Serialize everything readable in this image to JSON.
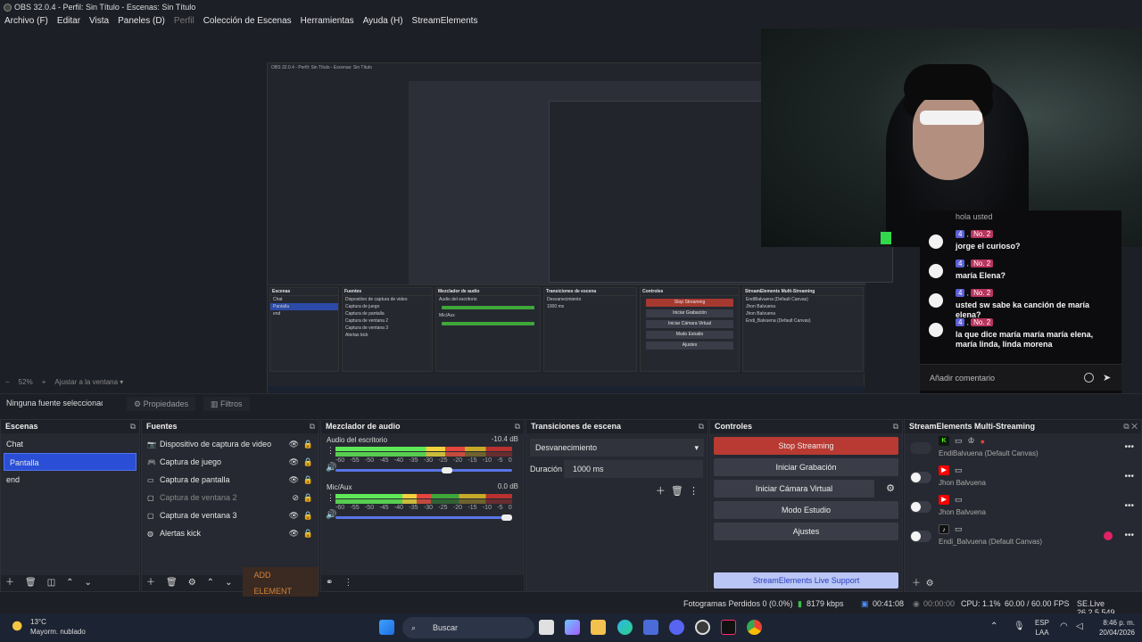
{
  "window_title": "OBS 32.0.4 - Perfil: Sin Título - Escenas: Sin Título",
  "menu": [
    "Archivo (F)",
    "Editar",
    "Vista",
    "Paneles (D)",
    "Perfil",
    "Colección de Escenas",
    "Herramientas",
    "Ayuda (H)",
    "StreamElements"
  ],
  "zoom": {
    "minus": "−",
    "value": "52%",
    "plus": "+",
    "fit": "Ajustar a la ventana"
  },
  "source_bar": {
    "label": "Ninguna fuente seleccionada",
    "properties": "Propiedades",
    "filters": "Filtros"
  },
  "chat": {
    "messages": [
      {
        "badge1": "4",
        "badge2": "No. 2",
        "text": "jorge el curioso?"
      },
      {
        "badge1": "4",
        "badge2": "No. 2",
        "text": "maría Elena?"
      },
      {
        "badge1": "4",
        "badge2": "No. 2",
        "text": "usted sw sabe ka canción de maría elena?"
      },
      {
        "badge1": "4",
        "badge2": "No. 2",
        "text": "la que dice maría maría maría elena, maría linda, linda morena"
      }
    ],
    "partial_top": "hola usted",
    "placeholder": "Añadir comentario"
  },
  "scenes": {
    "title": "Escenas",
    "items": [
      "Chat",
      "Pantalla",
      "end"
    ],
    "selected": 1
  },
  "sources": {
    "title": "Fuentes",
    "items": [
      {
        "label": "Dispositivo de captura de video",
        "icon": "camera",
        "dim": false
      },
      {
        "label": "Captura de juego",
        "icon": "gamepad",
        "dim": false
      },
      {
        "label": "Captura de pantalla",
        "icon": "monitor",
        "dim": false
      },
      {
        "label": "Captura de ventana 2",
        "icon": "window",
        "dim": true
      },
      {
        "label": "Captura de ventana 3",
        "icon": "window",
        "dim": false
      },
      {
        "label": "Alertas kick",
        "icon": "globe",
        "dim": false
      }
    ],
    "add_element": "ADD ELEMENT"
  },
  "mixer": {
    "title": "Mezclador de audio",
    "ticks": [
      "-60",
      "-55",
      "-50",
      "-45",
      "-40",
      "-35",
      "-30",
      "-25",
      "-20",
      "-15",
      "-10",
      "-5",
      "0"
    ],
    "channels": [
      {
        "name": "Audio del escritorio",
        "db": "-10.4 dB",
        "level": 0.73,
        "volume": 0.63
      },
      {
        "name": "Mic/Aux",
        "db": "0.0 dB",
        "level": 0.54,
        "volume": 0.97
      }
    ]
  },
  "transitions": {
    "title": "Transiciones de escena",
    "selected": "Desvanecimiento",
    "duration_label": "Duración",
    "duration_value": "1000 ms"
  },
  "controls": {
    "title": "Controles",
    "buttons": [
      "Stop Streaming",
      "Iniciar Grabación",
      "Iniciar Cámara Virtual",
      "Modo Estudio",
      "Ajustes"
    ],
    "support": "StreamElements Live Support"
  },
  "multistream": {
    "title": "StreamElements Multi-Streaming",
    "rows": [
      {
        "name": "EndiBalvuena (Default Canvas)",
        "platform": "kick",
        "color": "#53fc18"
      },
      {
        "name": "Jhon Balvuena",
        "platform": "youtube",
        "color": "#ff0000"
      },
      {
        "name": "Jhon Balvuena",
        "platform": "youtube",
        "color": "#ff0000"
      },
      {
        "name": "Endi_Balvuena (Default Canvas)",
        "platform": "tiktok",
        "color": "#222222"
      }
    ]
  },
  "status": {
    "frames_dropped": "Fotogramas Perdidos 0 (0.0%)",
    "bitrate": "8179 kbps",
    "stream_time": "00:41:08",
    "rec_time": "00:00:00",
    "cpu": "CPU: 1.1%",
    "fps": "60.00 / 60.00 FPS",
    "version": "SE.Live 26.2.5.549"
  },
  "taskbar": {
    "weather_temp": "13°C",
    "weather_desc": "Mayorm. nublado",
    "search": "Buscar",
    "lang1": "ESP",
    "lang2": "LAA",
    "time": "8:46 p. m.",
    "date": "20/04/2026"
  }
}
